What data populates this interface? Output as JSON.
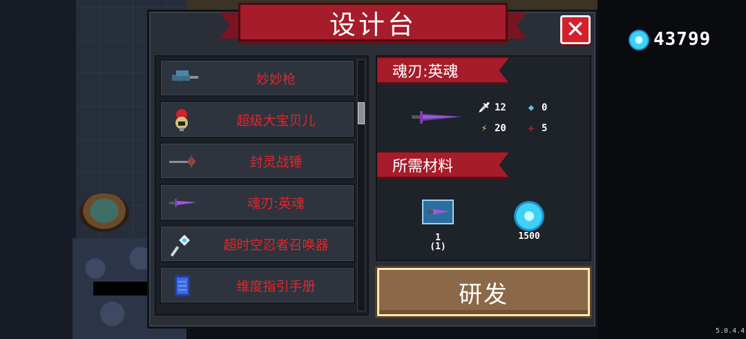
{
  "header": {
    "title": "设计台"
  },
  "currency": {
    "gems": "43799",
    "icon": "gem-icon"
  },
  "version": "5.0.4.4",
  "list": {
    "items": [
      {
        "label": "妙妙枪",
        "icon": "blue-gun-icon"
      },
      {
        "label": "超级大宝贝儿",
        "icon": "bomb-doll-icon"
      },
      {
        "label": "封灵战锤",
        "icon": "spiked-hammer-icon"
      },
      {
        "label": "魂刃:英魂",
        "icon": "purple-blade-icon"
      },
      {
        "label": "超时空忍者召唤器",
        "icon": "summoner-staff-icon"
      },
      {
        "label": "维度指引手册",
        "icon": "blue-manual-icon"
      }
    ]
  },
  "detail": {
    "name": "魂刃:英魂",
    "stats": {
      "damage": "12",
      "energy": "0",
      "crit": "20",
      "precision": "5"
    },
    "materials_title": "所需材料",
    "materials": [
      {
        "icon": "blueprint-icon",
        "count_top": "1",
        "count_bottom": "(1)"
      },
      {
        "icon": "gem-icon",
        "count_top": "1500",
        "count_bottom": ""
      }
    ]
  },
  "actions": {
    "develop_label": "研发"
  },
  "colors": {
    "banner_red": "#a61c2a",
    "item_label_red": "#e2252c",
    "button_brown": "#8b6848",
    "gem_cyan": "#3fd0f5"
  }
}
